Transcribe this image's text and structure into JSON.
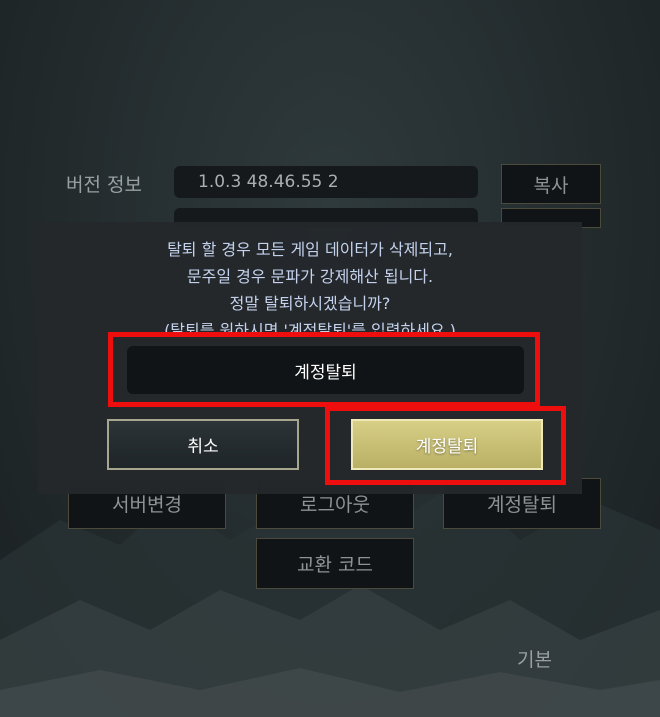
{
  "settings": {
    "version_label": "버전 정보",
    "version_value": "1.0.3 48.46.55 2",
    "copy_button": "복사",
    "server_change_button": "서버변경",
    "logout_button": "로그아웃",
    "delete_account_button": "계정탈퇴",
    "exchange_code_button": "교환 코드",
    "basic_label": "기본"
  },
  "dialog": {
    "message_lines": [
      "탈퇴 할 경우 모든 게임 데이터가 삭제되고,",
      "문주일 경우 문파가 강제해산 됩니다.",
      "정말 탈퇴하시겠습니까?",
      "(탈퇴를 원하시면 '계정탈퇴'를 입력하세요.)"
    ],
    "input_value": "계정탈퇴",
    "cancel_button": "취소",
    "confirm_button": "계정탈퇴"
  },
  "colors": {
    "highlight": "#ee0e0e",
    "message_text": "#c4d2ee",
    "confirm_gold": "#d8cf86"
  }
}
